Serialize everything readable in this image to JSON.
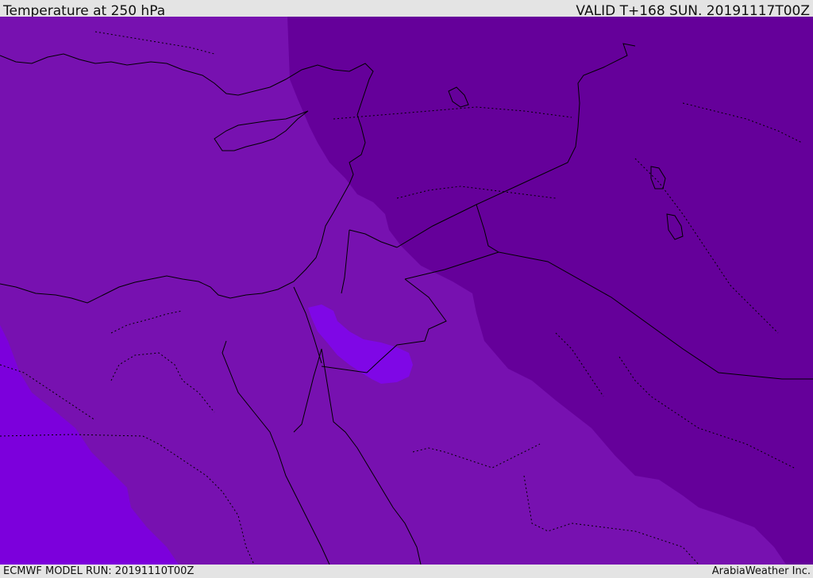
{
  "header": {
    "title": "Temperature at 250 hPa",
    "valid": "VALID T+168 SUN. 20191117T00Z"
  },
  "footer": {
    "model_run": "ECMWF MODEL RUN: 20191110T00Z",
    "credit": "ArabiaWeather Inc."
  },
  "map": {
    "colors": {
      "cold_band": "#65009a",
      "mid_band": "#7711b0",
      "warm_band": "#7c00dc",
      "warm_patch": "#7f07e6",
      "boundary_line": "#000000"
    }
  }
}
